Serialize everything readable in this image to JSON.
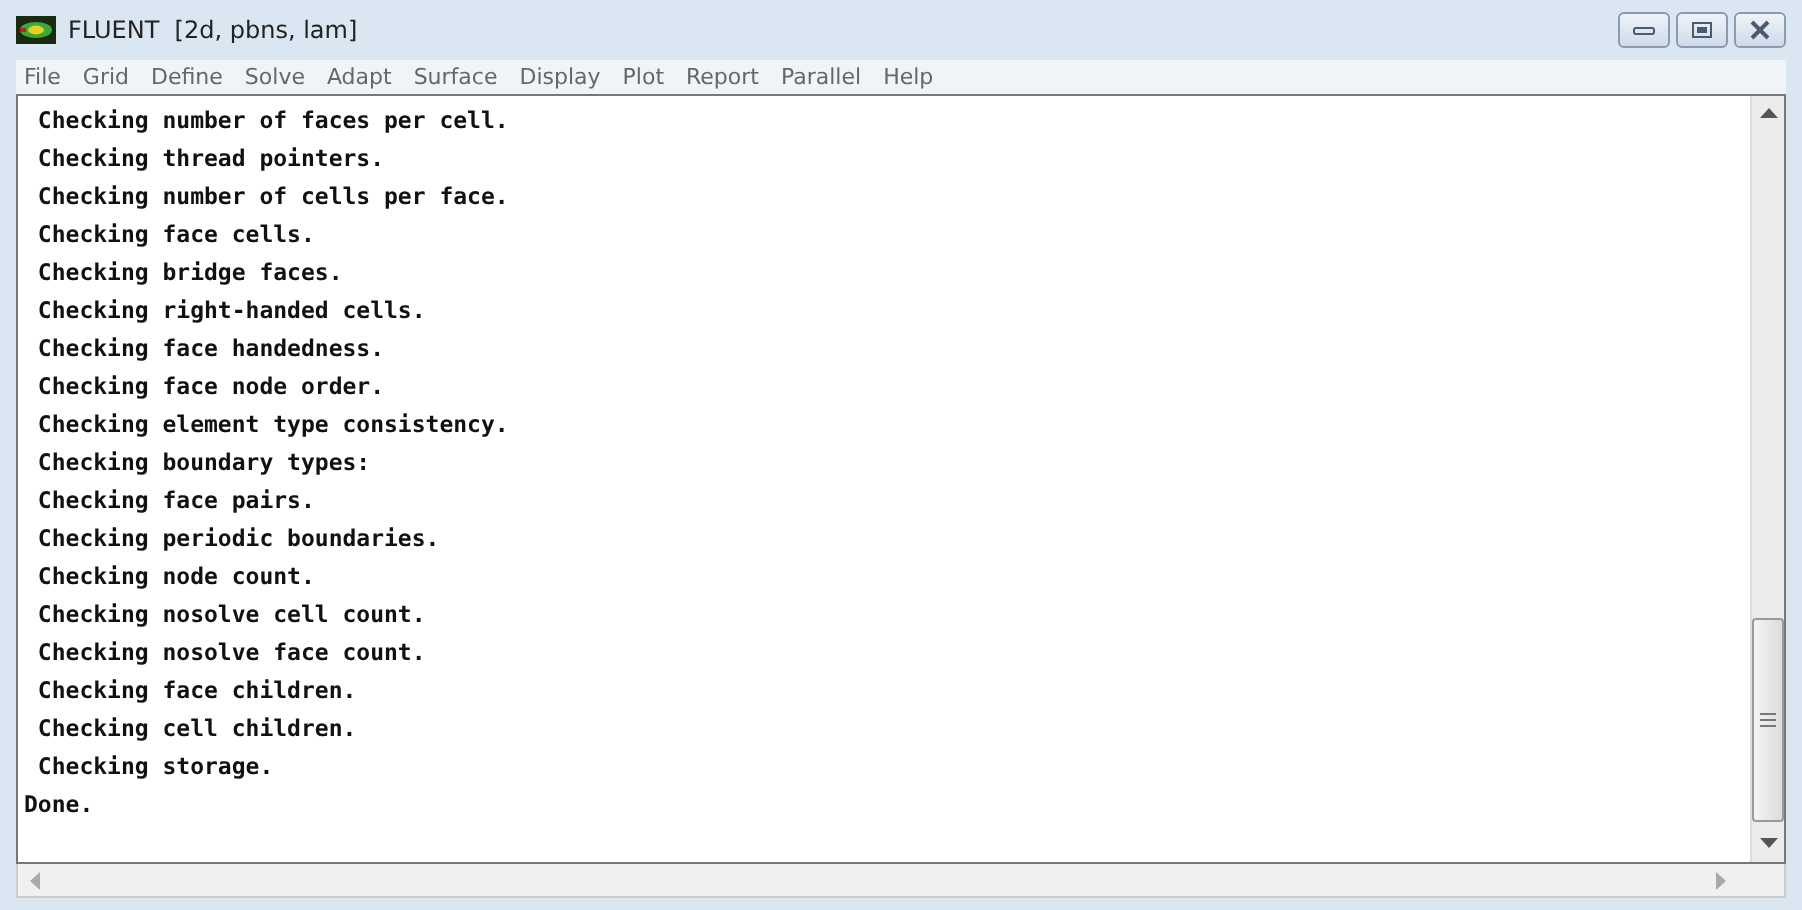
{
  "window": {
    "title": "FLUENT  [2d, pbns, lam]"
  },
  "menu": [
    "File",
    "Grid",
    "Define",
    "Solve",
    "Adapt",
    "Surface",
    "Display",
    "Plot",
    "Report",
    "Parallel",
    "Help"
  ],
  "console": {
    "lines": [
      " Checking number of faces per cell.",
      " Checking thread pointers.",
      " Checking number of cells per face.",
      " Checking face cells.",
      " Checking bridge faces.",
      " Checking right-handed cells.",
      " Checking face handedness.",
      " Checking face node order.",
      " Checking element type consistency.",
      " Checking boundary types:",
      " Checking face pairs.",
      " Checking periodic boundaries.",
      " Checking node count.",
      " Checking nosolve cell count.",
      " Checking nosolve face count.",
      " Checking face children.",
      " Checking cell children.",
      " Checking storage.",
      "Done."
    ]
  }
}
